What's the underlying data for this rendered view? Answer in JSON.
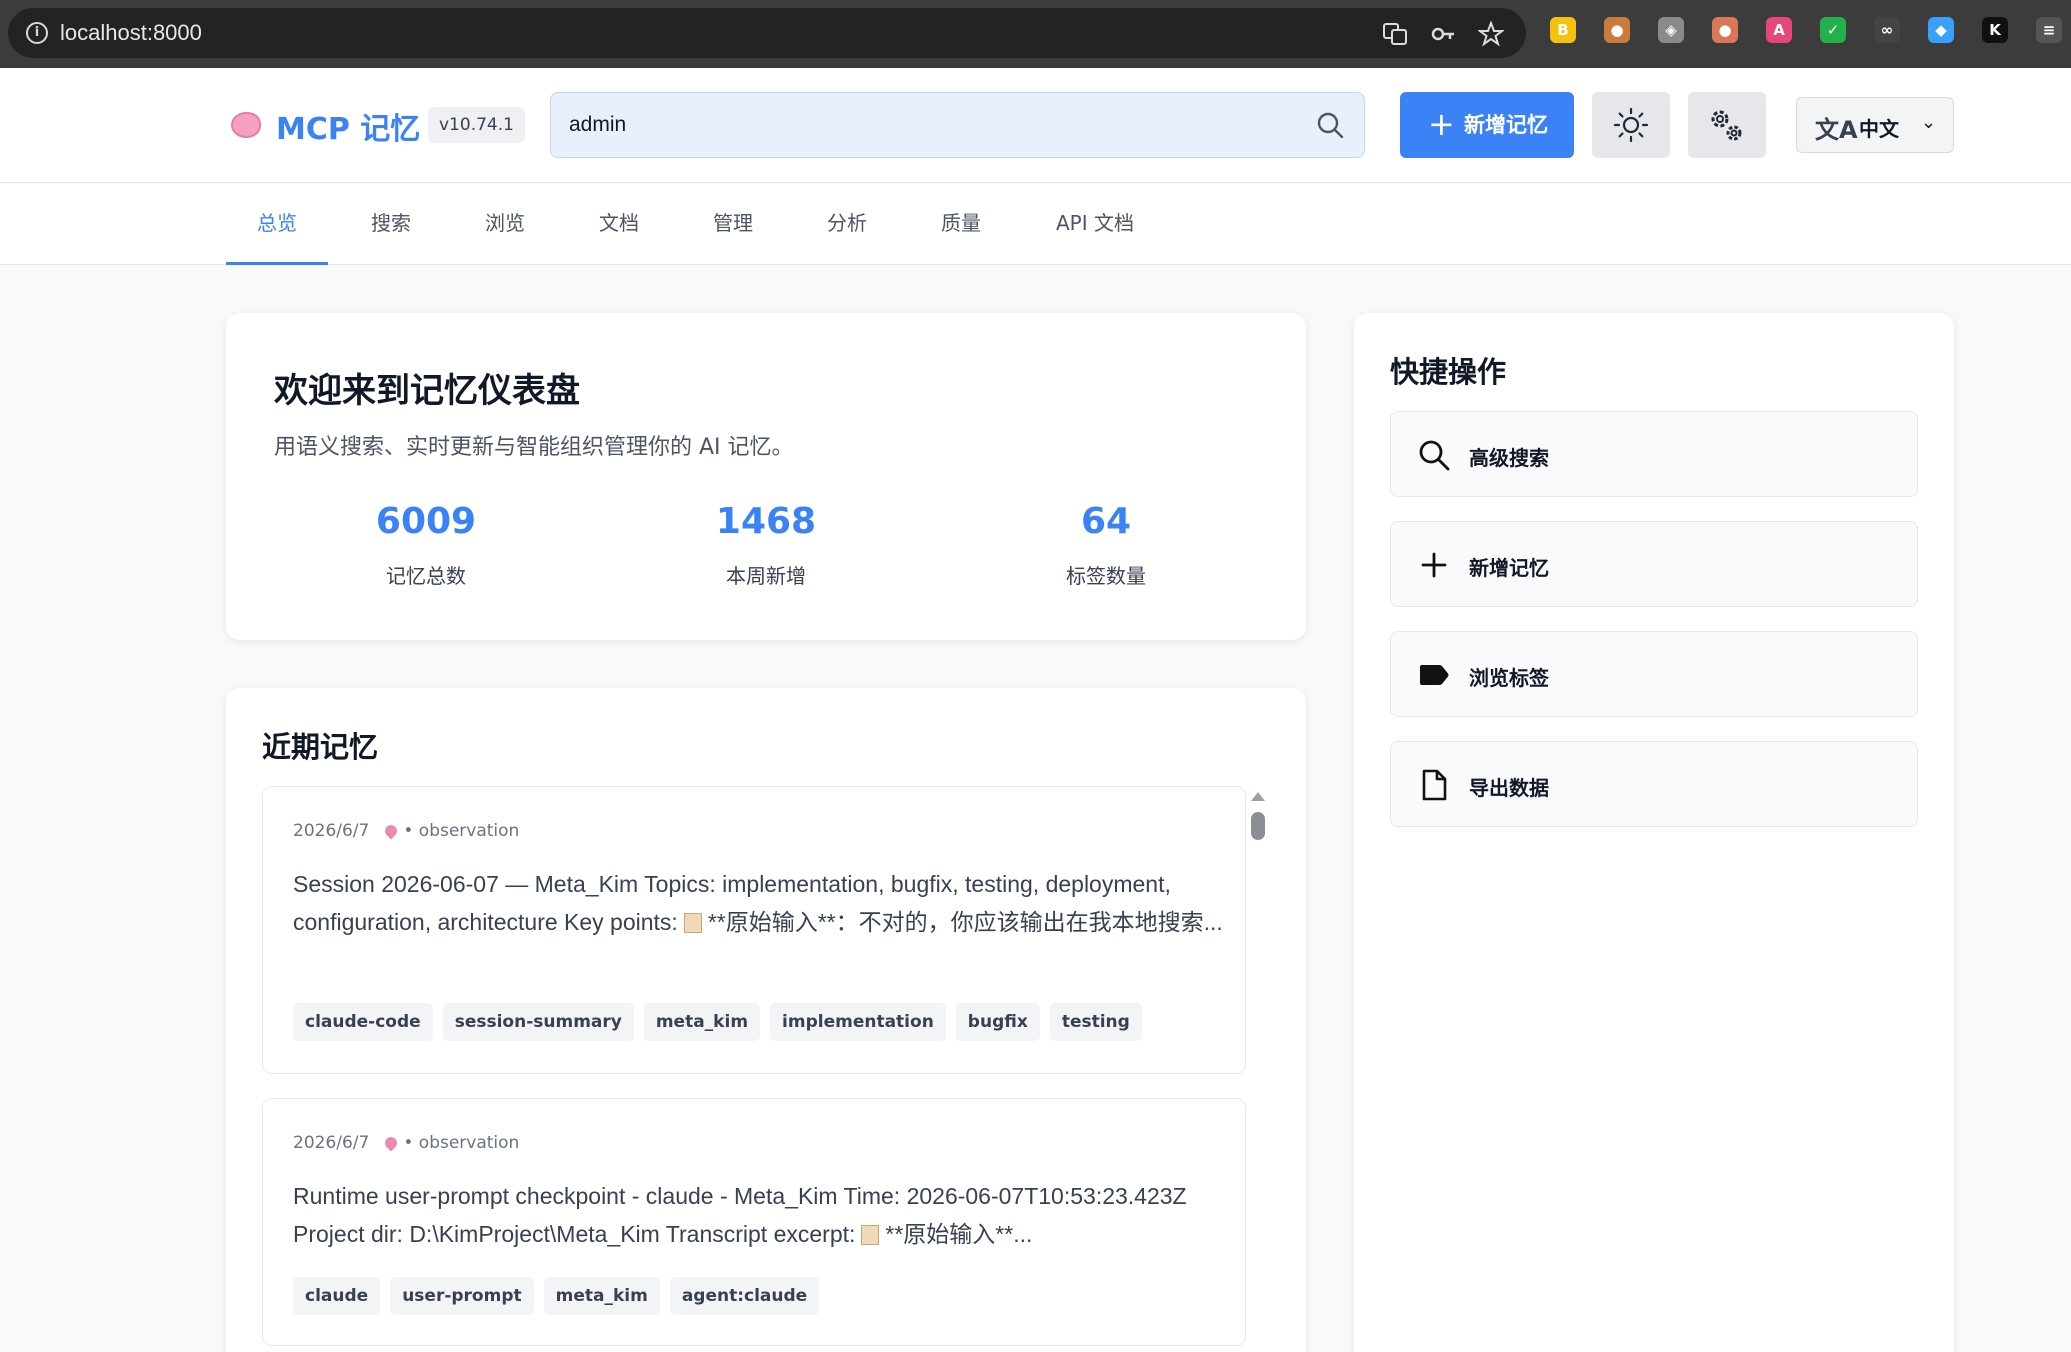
{
  "browser": {
    "url": "localhost:8000",
    "info_glyph": "i",
    "extensions": [
      {
        "name": "ext-yellow",
        "glyph": "B",
        "color": "#f4c20d"
      },
      {
        "name": "ext-cookie",
        "glyph": "●",
        "color": "#c97b3d"
      },
      {
        "name": "ext-diamond",
        "glyph": "◈",
        "color": "#8a8a8a"
      },
      {
        "name": "ext-bear",
        "glyph": "●",
        "color": "#d97757"
      },
      {
        "name": "ext-translate",
        "glyph": "A",
        "color": "#e8457c"
      },
      {
        "name": "ext-check",
        "glyph": "✓",
        "color": "#22b14c"
      },
      {
        "name": "ext-glasses",
        "glyph": "∞",
        "color": "#444444"
      },
      {
        "name": "ext-gem",
        "glyph": "◆",
        "color": "#3aa0ff"
      },
      {
        "name": "ext-k",
        "glyph": "K",
        "color": "#111111"
      },
      {
        "name": "ext-menu",
        "glyph": "≡",
        "color": "#555555"
      }
    ]
  },
  "header": {
    "title": "MCP 记忆",
    "version": "v10.74.1",
    "search_value": "admin",
    "search_placeholder": "",
    "add_label": "新增记忆",
    "add_glyph": "+",
    "language": "中文",
    "language_glyph": "文A",
    "chevron": "⌄"
  },
  "nav": {
    "tabs": [
      {
        "label": "总览",
        "active": true
      },
      {
        "label": "搜索"
      },
      {
        "label": "浏览"
      },
      {
        "label": "文档"
      },
      {
        "label": "管理"
      },
      {
        "label": "分析"
      },
      {
        "label": "质量"
      },
      {
        "label": "API 文档"
      }
    ]
  },
  "welcome": {
    "title": "欢迎来到记忆仪表盘",
    "subtitle": "用语义搜索、实时更新与智能组织管理你的 AI 记忆。",
    "stats": [
      {
        "value": "6009",
        "label": "记忆总数"
      },
      {
        "value": "1468",
        "label": "本周新增"
      },
      {
        "value": "64",
        "label": "标签数量"
      }
    ]
  },
  "recent": {
    "title": "近期记忆",
    "items": [
      {
        "date": "2026/6/7",
        "type": "• observation",
        "text_before": "Session 2026-06-07 — Meta_Kim Topics: implementation, bugfix, testing, deployment, configuration, architecture Key points:",
        "text_after": "**原始输入**：不对的，你应该输出在我本地搜索...",
        "tags": [
          "claude-code",
          "session-summary",
          "meta_kim",
          "implementation",
          "bugfix",
          "testing"
        ]
      },
      {
        "date": "2026/6/7",
        "type": "• observation",
        "text_before": "Runtime user-prompt checkpoint - claude - Meta_Kim Time: 2026-06-07T10:53:23.423Z Project dir: D:\\KimProject\\Meta_Kim Transcript excerpt:",
        "text_after": "**原始输入**...",
        "tags": [
          "claude",
          "user-prompt",
          "meta_kim",
          "agent:claude"
        ]
      }
    ]
  },
  "quick": {
    "title": "快捷操作",
    "actions": [
      {
        "label": "高级搜索",
        "icon": "search-icon"
      },
      {
        "label": "新增记忆",
        "icon": "plus-icon"
      },
      {
        "label": "浏览标签",
        "icon": "tag-icon"
      },
      {
        "label": "导出数据",
        "icon": "file-icon"
      }
    ]
  },
  "colors": {
    "accent": "#3b82f6",
    "background": "#f7f9fb",
    "chrome": "#3c3c3c"
  }
}
